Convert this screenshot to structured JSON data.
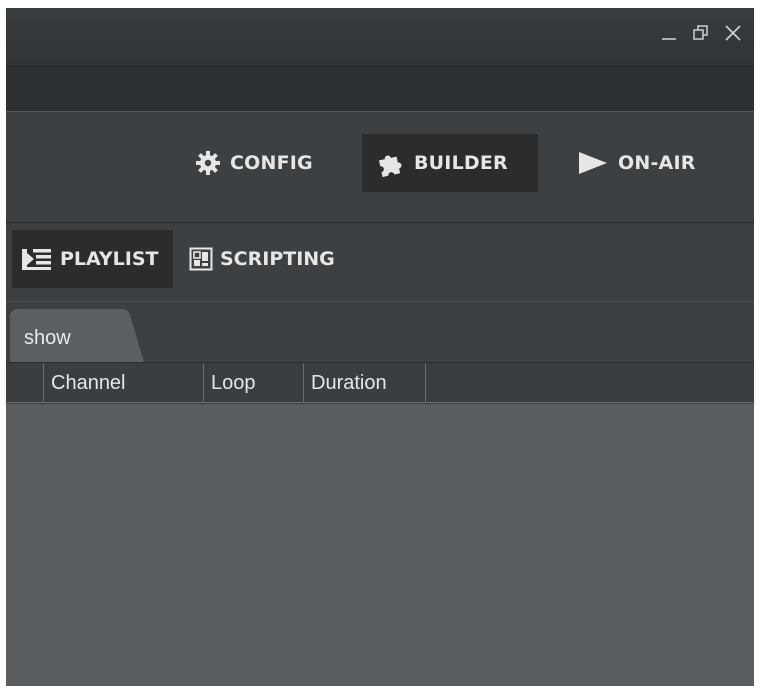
{
  "window_controls": {
    "minimize_icon": "minimize-icon",
    "restore_icon": "restore-icon",
    "close_icon": "close-icon"
  },
  "modes": [
    {
      "label": "CONFIG",
      "icon": "gear-icon",
      "active": false
    },
    {
      "label": "BUILDER",
      "icon": "puzzle-icon",
      "active": true
    },
    {
      "label": "ON-AIR",
      "icon": "play-icon",
      "active": false
    }
  ],
  "subtabs": [
    {
      "label": "PLAYLIST",
      "icon": "playlist-icon",
      "active": true
    },
    {
      "label": "SCRIPTING",
      "icon": "scripting-icon",
      "active": false
    }
  ],
  "document_tab": {
    "label": "show"
  },
  "table": {
    "columns": [
      "",
      "Channel",
      "Loop",
      "Duration"
    ],
    "rows": []
  },
  "colors": {
    "background": "#3d4043",
    "active_button": "#2a2c2e",
    "table_body": "#5a5d60",
    "text": "#e6e6e6"
  }
}
